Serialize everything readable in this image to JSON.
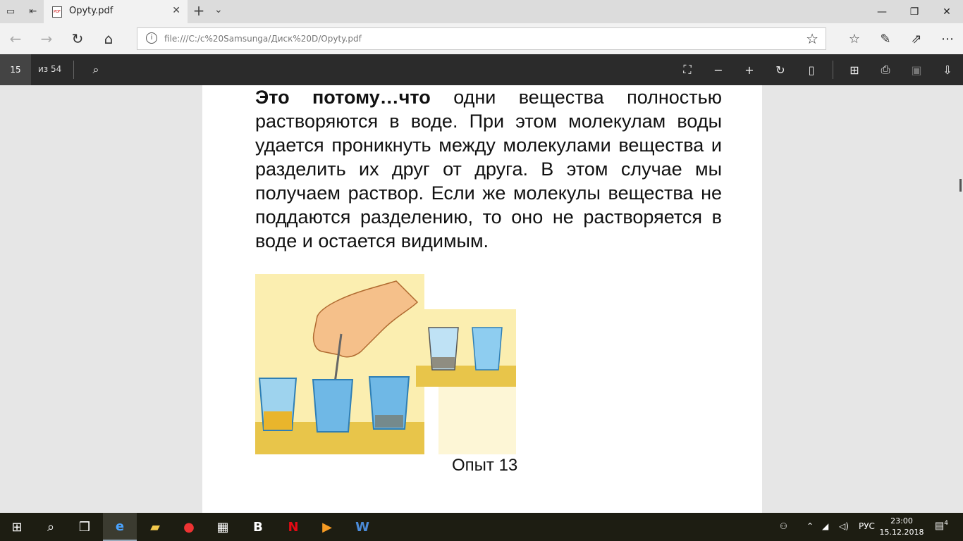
{
  "tab": {
    "title": "Opyty.pdf",
    "pdf_glyph": "PDF"
  },
  "address": {
    "url": "file:///C:/c%20Samsunga/Диск%20D/Opyty.pdf"
  },
  "pdf_toolbar": {
    "page_current": "15",
    "page_total": "из 54"
  },
  "document": {
    "lead_bold": "Это потому…что",
    "body": " одни вещества полностью растворяются в воде. При этом молекулам воды удается проникнуть между молекулами вещества и разделить их друг от друга. В этом случае мы получаем раствор. Если же молекулы вещества не поддаются разделению, то оно не растворяется в воде и остается видимым.",
    "caption": "Опыт 13"
  },
  "taskbar": {
    "lang": "РУС",
    "time": "23:00",
    "date": "15.12.2018",
    "notification_count": "4",
    "apps": [
      "start-icon",
      "search-icon",
      "task-view-icon",
      "edge-icon",
      "file-explorer-icon",
      "yandex-icon",
      "store-icon",
      "booking-icon",
      "netflix-icon",
      "video-icon",
      "word-icon"
    ]
  },
  "colors": {
    "tabbar": "#dcdcdc",
    "pdf_toolbar": "#2b2b2b",
    "taskbar": "#1d1d12",
    "edge_blue": "#1e6fd0"
  }
}
